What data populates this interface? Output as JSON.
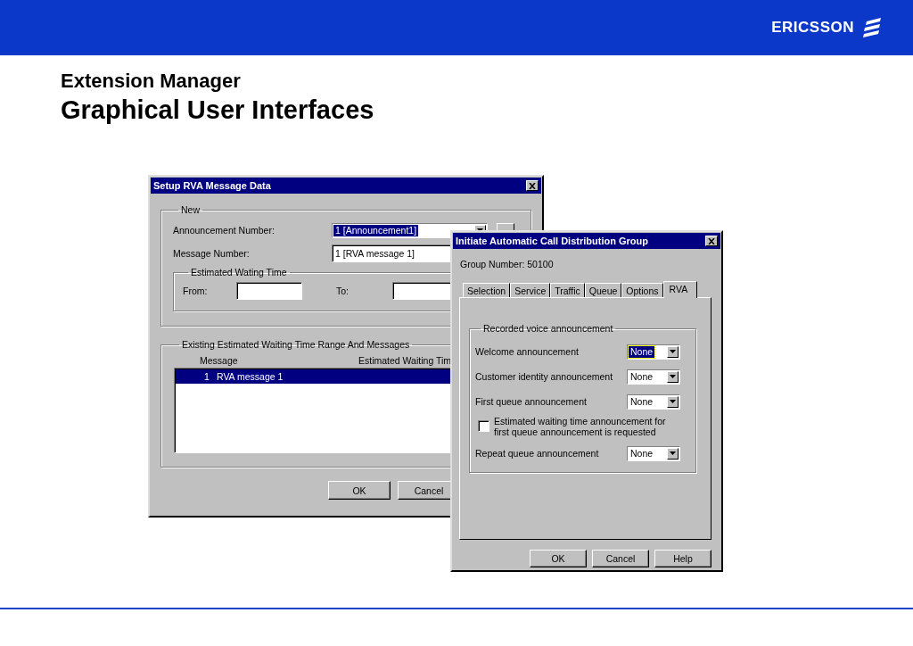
{
  "slide": {
    "brand": "ERICSSON",
    "subtitle": "Extension Manager",
    "title": "Graphical User Interfaces"
  },
  "setup_dialog": {
    "title": "Setup RVA Message Data",
    "new_group": {
      "label": "New",
      "announcement_label": "Announcement Number:",
      "announcement_value": "1 [Announcement1]",
      "announcement_focused": true,
      "message_label": "Message Number:",
      "message_value": "1 [RVA message 1]",
      "waiting_group": {
        "label": "Estimated Wating Time",
        "from_label": "From:",
        "to_label": "To:"
      }
    },
    "existing_group": {
      "label": "Existing Estimated Waiting Time Range And Messages",
      "columns": [
        "Message",
        "Estimated Waiting Tim"
      ],
      "rows": [
        {
          "number": "1",
          "message": "RVA message 1",
          "selected": true
        }
      ]
    },
    "buttons": [
      "OK",
      "Cancel"
    ]
  },
  "acd_dialog": {
    "title": "Initiate Automatic Call Distribution Group",
    "group_number": "Group Number: 50100",
    "tabs": [
      {
        "label": "Selection",
        "selected": false
      },
      {
        "label": "Service",
        "selected": false
      },
      {
        "label": "Traffic",
        "selected": false
      },
      {
        "label": "Queue",
        "selected": false
      },
      {
        "label": "Options",
        "selected": false
      },
      {
        "label": "RVA",
        "selected": true
      }
    ],
    "group_label": "Recorded voice announcement",
    "rows": [
      {
        "kind": "combo",
        "label": "Welcome announcement",
        "value": "None",
        "focused": true
      },
      {
        "kind": "combo",
        "label": "Customer identity announcement",
        "value": "None",
        "focused": false
      },
      {
        "kind": "combo",
        "label": "First queue announcement",
        "value": "None",
        "focused": false
      },
      {
        "kind": "checkbox",
        "label": "Estimated waiting time announcement for first queue announcement is requested",
        "checked": false
      },
      {
        "kind": "combo",
        "label": "Repeat  queue announcement",
        "value": "None",
        "focused": false
      }
    ],
    "buttons": [
      "OK",
      "Cancel",
      "Help"
    ]
  }
}
